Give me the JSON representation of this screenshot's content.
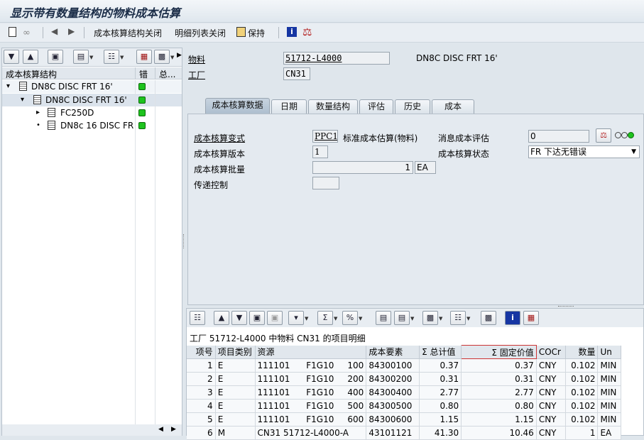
{
  "window": {
    "title": "显示带有数量结构的物料成本估算"
  },
  "toolbar": {
    "btn_struct_off": "成本核算结构关闭",
    "btn_list_off": "明细列表关闭",
    "btn_keep": "保持"
  },
  "tree": {
    "headers": [
      "成本核算结构",
      "错",
      "总..."
    ],
    "rows": [
      {
        "label": "DN8C DISC FRT 16'",
        "level": 0,
        "expand": "▾"
      },
      {
        "label": "DN8C DISC FRT 16'",
        "level": 1,
        "expand": "▾"
      },
      {
        "label": "FC250D",
        "level": 2,
        "expand": "▸"
      },
      {
        "label": "DN8c 16 DISC FR",
        "level": 2,
        "expand": "•"
      }
    ]
  },
  "header": {
    "material_label": "物料",
    "material_value": "51712-L4000",
    "material_desc": "DN8C DISC FRT 16'",
    "plant_label": "工厂",
    "plant_value": "CN31"
  },
  "tabs": [
    "成本核算数据",
    "日期",
    "数量结构",
    "评估",
    "历史",
    "成本"
  ],
  "costing": {
    "variant_label": "成本核算变式",
    "variant_value": "PPC1",
    "variant_desc": "标准成本估算(物料)",
    "version_label": "成本核算版本",
    "version_value": "1",
    "lot_label": "成本核算批量",
    "lot_value": "1",
    "lot_unit": "EA",
    "transfer_label": "传递控制",
    "transfer_value": "",
    "msg_label": "消息成本评估",
    "msg_value": "0",
    "status_label": "成本核算状态",
    "status_value": "FR 下达无错误"
  },
  "detail": {
    "title": "工厂 51712-L4000 中物料 CN31 的项目明细",
    "columns": [
      "项号",
      "项目类别",
      "资源",
      "成本要素",
      "Σ 总计值",
      "Σ 固定价值",
      "COCr",
      "数量",
      "Un"
    ],
    "rows": [
      [
        "1",
        "E",
        "111101      F1G10     100",
        "84300100",
        "0.37",
        "0.37",
        "CNY",
        "0.102",
        "MIN"
      ],
      [
        "2",
        "E",
        "111101      F1G10     200",
        "84300200",
        "0.31",
        "0.31",
        "CNY",
        "0.102",
        "MIN"
      ],
      [
        "3",
        "E",
        "111101      F1G10     400",
        "84300400",
        "2.77",
        "2.77",
        "CNY",
        "0.102",
        "MIN"
      ],
      [
        "4",
        "E",
        "111101      F1G10     500",
        "84300500",
        "0.80",
        "0.80",
        "CNY",
        "0.102",
        "MIN"
      ],
      [
        "5",
        "E",
        "111101      F1G10     600",
        "84300600",
        "1.15",
        "1.15",
        "CNY",
        "0.102",
        "MIN"
      ],
      [
        "6",
        "M",
        "CN31 51712-L4000-A",
        "43101121",
        "41.30",
        "10.46",
        "CNY",
        "1",
        "EA"
      ]
    ]
  },
  "colors": {
    "accent": "#1b2d48",
    "green": "#1ec31e"
  }
}
